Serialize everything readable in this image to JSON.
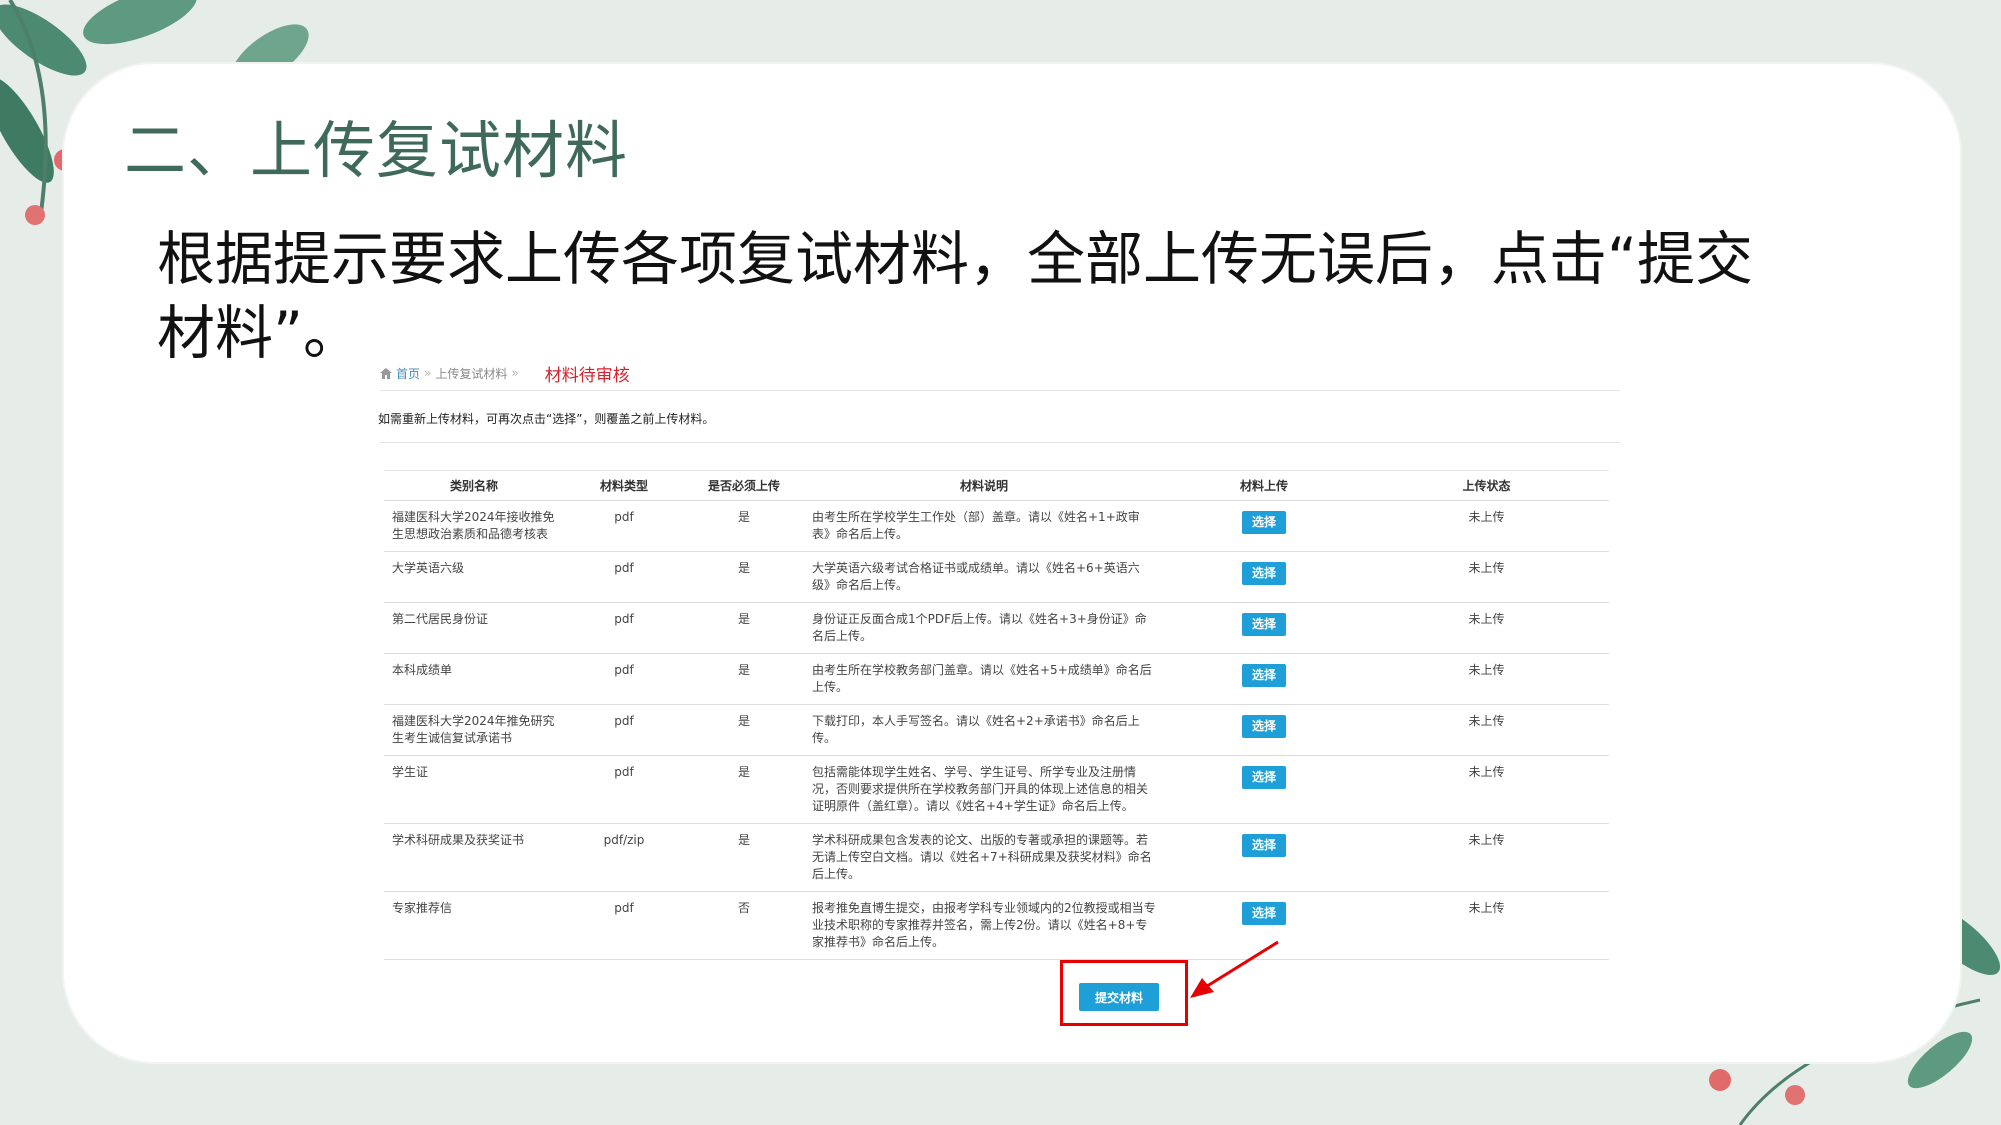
{
  "slide": {
    "title": "二、上传复试材料",
    "body": "根据提示要求上传各项复试材料，全部上传无误后，点击“提交材料”。"
  },
  "breadcrumb": {
    "home": "首页",
    "sep1": "»",
    "page": "上传复试材料",
    "sep2": "»",
    "status": "材料待审核"
  },
  "notice": "如需重新上传材料，可再次点击“选择”，则覆盖之前上传材料。",
  "table": {
    "headers": [
      "类别名称",
      "材料类型",
      "是否必须上传",
      "材料说明",
      "材料上传",
      "上传状态"
    ],
    "select_label": "选择",
    "rows": [
      {
        "name": "福建医科大学2024年接收推免生思想政治素质和品德考核表",
        "type": "pdf",
        "required": "是",
        "desc": "由考生所在学校学生工作处（部）盖章。请以《姓名+1+政审表》命名后上传。",
        "status": "未上传"
      },
      {
        "name": "大学英语六级",
        "type": "pdf",
        "required": "是",
        "desc": "大学英语六级考试合格证书或成绩单。请以《姓名+6+英语六级》命名后上传。",
        "status": "未上传"
      },
      {
        "name": "第二代居民身份证",
        "type": "pdf",
        "required": "是",
        "desc": "身份证正反面合成1个PDF后上传。请以《姓名+3+身份证》命名后上传。",
        "status": "未上传"
      },
      {
        "name": "本科成绩单",
        "type": "pdf",
        "required": "是",
        "desc": "由考生所在学校教务部门盖章。请以《姓名+5+成绩单》命名后上传。",
        "status": "未上传"
      },
      {
        "name": "福建医科大学2024年推免研究生考生诚信复试承诺书",
        "type": "pdf",
        "required": "是",
        "desc": "下载打印，本人手写签名。请以《姓名+2+承诺书》命名后上传。",
        "status": "未上传"
      },
      {
        "name": "学生证",
        "type": "pdf",
        "required": "是",
        "desc": "包括需能体现学生姓名、学号、学生证号、所学专业及注册情况，否则要求提供所在学校教务部门开具的体现上述信息的相关证明原件（盖红章）。请以《姓名+4+学生证》命名后上传。",
        "status": "未上传"
      },
      {
        "name": "学术科研成果及获奖证书",
        "type": "pdf/zip",
        "required": "是",
        "desc": "学术科研成果包含发表的论文、出版的专著或承担的课题等。若无请上传空白文档。请以《姓名+7+科研成果及获奖材料》命名后上传。",
        "status": "未上传"
      },
      {
        "name": "专家推荐信",
        "type": "pdf",
        "required": "否",
        "desc": "报考推免直博生提交，由报考学科专业领域内的2位教授或相当专业技术职称的专家推荐并签名，需上传2份。请以《姓名+8+专家推荐书》命名后上传。",
        "status": "未上传"
      }
    ]
  },
  "submit_label": "提交材料",
  "colors": {
    "title_green": "#3f6a5b",
    "button_blue": "#1e9fd8",
    "highlight_red": "#e60000",
    "status_red": "#d4232d"
  }
}
